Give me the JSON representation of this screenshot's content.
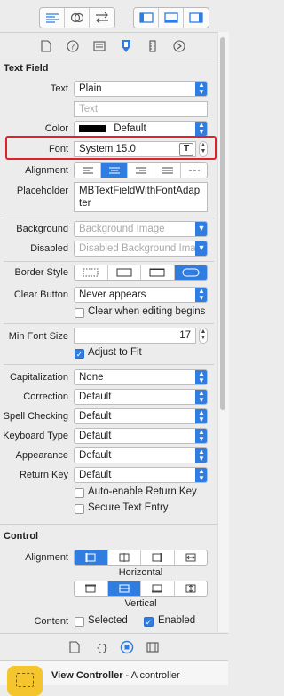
{
  "toolbar": {
    "icons_left": [
      "align-left-icon",
      "circles-overlap-icon",
      "arrows-swap-icon"
    ],
    "icons_right": [
      "left-panel-icon",
      "bottom-panel-icon",
      "right-panel-icon"
    ]
  },
  "inspector_tabs": [
    "file-icon",
    "help-icon",
    "identity-icon",
    "attributes-icon",
    "size-icon",
    "connections-icon"
  ],
  "text_field": {
    "title": "Text Field",
    "text_label": "Text",
    "text_value": "Plain",
    "text_placeholder": "Text",
    "color_label": "Color",
    "color_value": "Default",
    "font_label": "Font",
    "font_value": "System 15.0",
    "alignment_label": "Alignment",
    "placeholder_label": "Placeholder",
    "placeholder_value": "MBTextFieldWithFontAdapter",
    "background_label": "Background",
    "background_placeholder": "Background Image",
    "disabled_label": "Disabled",
    "disabled_placeholder": "Disabled Background Image",
    "border_style_label": "Border Style",
    "clear_button_label": "Clear Button",
    "clear_button_value": "Never appears",
    "clear_when_editing": "Clear when editing begins",
    "min_font_label": "Min Font Size",
    "min_font_value": "17",
    "adjust_to_fit": "Adjust to Fit",
    "capitalization_label": "Capitalization",
    "capitalization_value": "None",
    "correction_label": "Correction",
    "correction_value": "Default",
    "spell_label": "Spell Checking",
    "spell_value": "Default",
    "keyboard_label": "Keyboard Type",
    "keyboard_value": "Default",
    "appearance_label": "Appearance",
    "appearance_value": "Default",
    "return_label": "Return Key",
    "return_value": "Default",
    "auto_enable": "Auto-enable Return Key",
    "secure": "Secure Text Entry"
  },
  "control": {
    "title": "Control",
    "alignment_label": "Alignment",
    "horizontal": "Horizontal",
    "vertical": "Vertical",
    "content_label": "Content",
    "selected": "Selected",
    "enabled": "Enabled"
  },
  "library_tabs": [
    "file-template-icon",
    "braces-icon",
    "object-icon",
    "media-icon"
  ],
  "library_item": {
    "title": "View Controller",
    "desc": " - A controller"
  },
  "colors": {
    "accent": "#2f7de1",
    "highlight": "#e0212b"
  }
}
